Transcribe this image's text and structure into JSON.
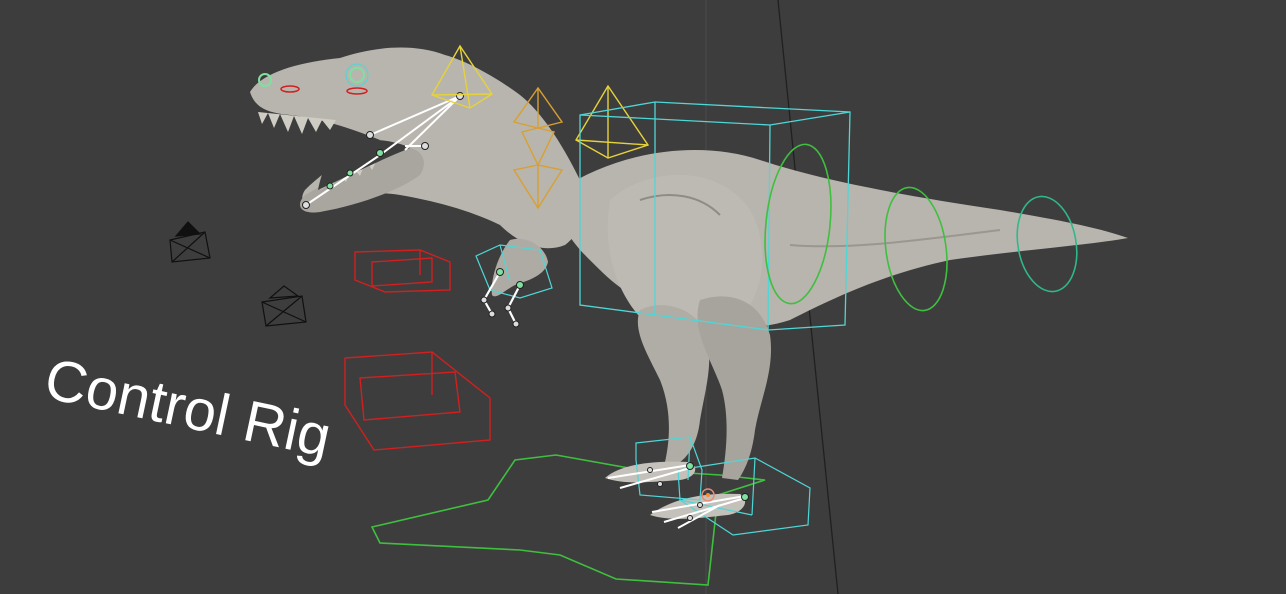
{
  "viewport": {
    "overlay_title": "Control Rig"
  },
  "colors": {
    "background": "#3d3d3d",
    "mesh": "#b8b5ae",
    "mesh_shadow": "#8f8c86",
    "bone_fk": "#ffffff",
    "bone_joint_selected": "#7fe0a0",
    "ctrl_cyan": "#4fd6d6",
    "ctrl_green": "#3fbf3f",
    "ctrl_yellow": "#e6d23a",
    "ctrl_orange": "#d9a030",
    "ctrl_red": "#d02020",
    "camera_black": "#101010"
  }
}
